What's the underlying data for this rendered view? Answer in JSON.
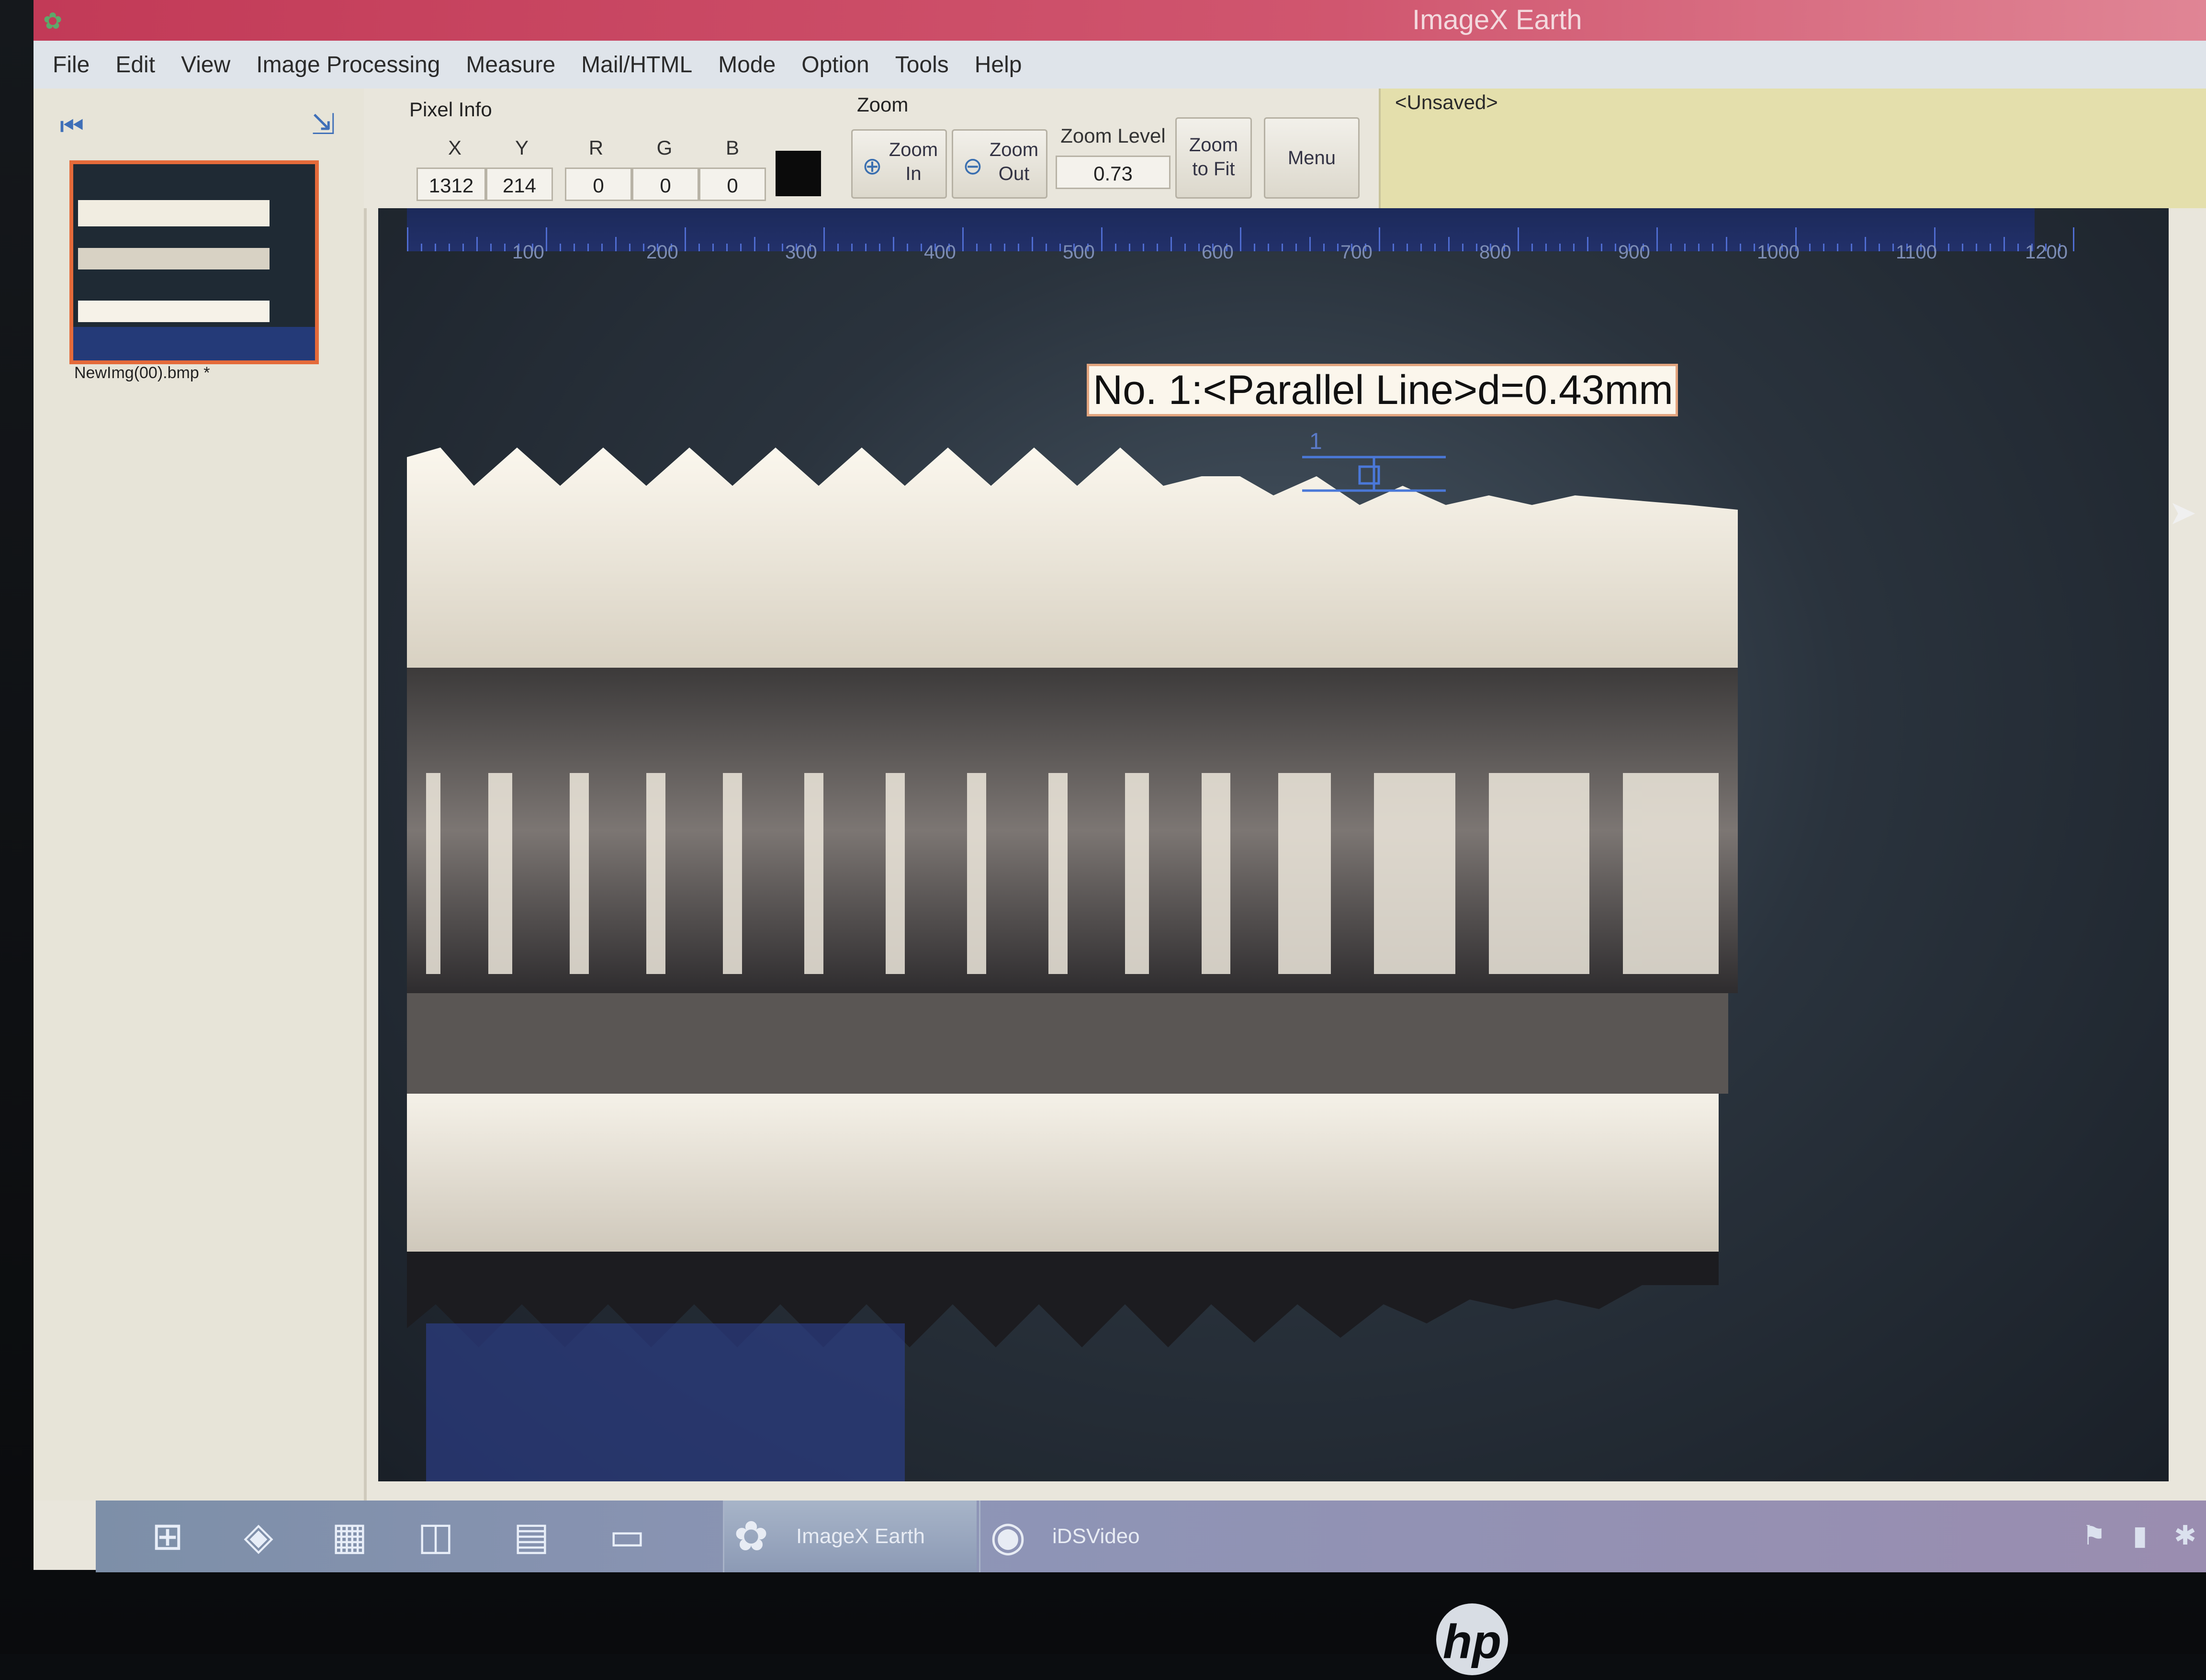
{
  "window": {
    "title": "ImageX Earth",
    "app_icon": "butterfly-icon"
  },
  "menu": {
    "items": [
      "File",
      "Edit",
      "View",
      "Image Processing",
      "Measure",
      "Mail/HTML",
      "Mode",
      "Option",
      "Tools",
      "Help"
    ]
  },
  "thumbnails": {
    "nav_first_icon": "skip-to-first-icon",
    "export_icon": "export-icon",
    "items": [
      {
        "caption": "NewImg(00).bmp *"
      }
    ]
  },
  "pixel_info": {
    "label": "Pixel Info",
    "x_label": "X",
    "x_value": "1312",
    "y_label": "Y",
    "y_value": "214",
    "r_label": "R",
    "r_value": "0",
    "g_label": "G",
    "g_value": "0",
    "b_label": "B",
    "b_value": "0",
    "swatch_color": "#0b0b0b"
  },
  "zoom": {
    "label": "Zoom",
    "zoom_in_line1": "Zoom",
    "zoom_in_line2": "In",
    "zoom_out_line1": "Zoom",
    "zoom_out_line2": "Out",
    "zoom_level_label": "Zoom Level",
    "zoom_level_value": "0.73",
    "zoom_fit_line1": "Zoom",
    "zoom_fit_line2": "to Fit",
    "menu_button": "Menu"
  },
  "document": {
    "status": "<Unsaved>"
  },
  "ruler": {
    "labels": [
      "100",
      "200",
      "300",
      "400",
      "500",
      "600",
      "700",
      "800",
      "900",
      "1000",
      "1100",
      "1200"
    ]
  },
  "measurement": {
    "label": "No. 1:<Parallel Line>d=0.43mm",
    "number": "1"
  },
  "taskbar": {
    "start_icon": "windows-start-icon",
    "pinned_icons": [
      "paint-icon",
      "calculator-icon",
      "3d-viewer-icon",
      "computer-icon",
      "folder-icon"
    ],
    "apps": [
      {
        "label": "ImageX Earth",
        "icon": "butterfly-icon",
        "active": true
      },
      {
        "label": "iDSVideo",
        "icon": "camera-icon",
        "active": false
      }
    ],
    "tray_icons": [
      "flag-icon",
      "network-icon",
      "bluetooth-icon"
    ]
  },
  "monitor": {
    "brand": "hp"
  },
  "colors": {
    "titlebar": "#c23a57",
    "doc_tab": "#e4dfac",
    "selection_border": "#e46a3a",
    "measure_line": "#4a78d8"
  }
}
